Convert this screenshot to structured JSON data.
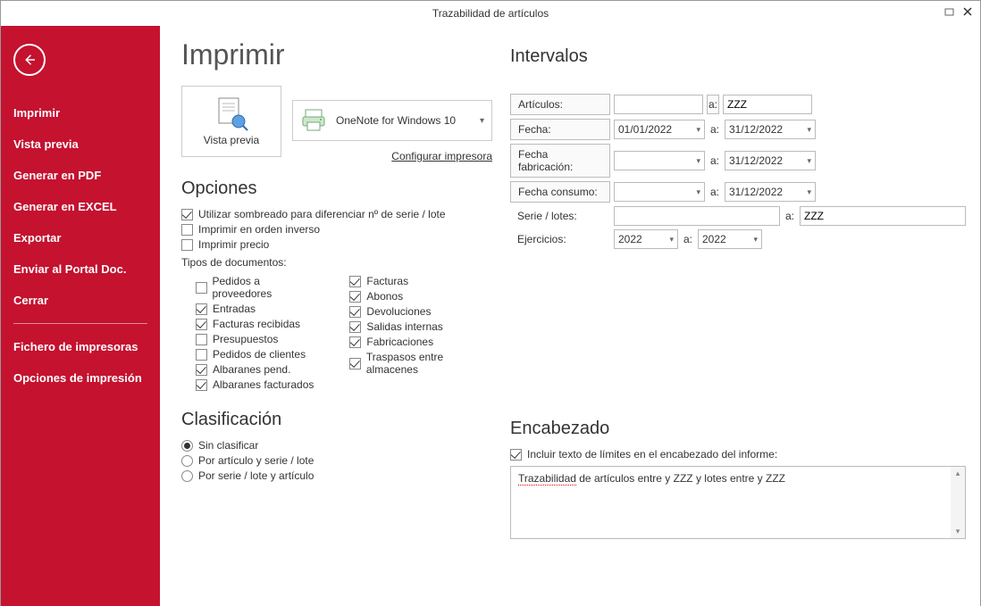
{
  "window": {
    "title": "Trazabilidad de artículos"
  },
  "sidebar": {
    "items": [
      "Imprimir",
      "Vista previa",
      "Generar en PDF",
      "Generar en EXCEL",
      "Exportar",
      "Enviar al Portal Doc.",
      "Cerrar"
    ],
    "items2": [
      "Fichero de impresoras",
      "Opciones de impresión"
    ]
  },
  "main": {
    "page_title": "Imprimir",
    "preview_label": "Vista previa",
    "printer_name": "OneNote for Windows 10",
    "config_link": "Configurar impresora",
    "opciones": {
      "title": "Opciones",
      "opt1": {
        "label": "Utilizar sombreado para diferenciar nº de serie / lote",
        "checked": true
      },
      "opt2": {
        "label": "Imprimir en orden inverso",
        "checked": false
      },
      "opt3": {
        "label": "Imprimir precio",
        "checked": false
      },
      "docs_label": "Tipos de documentos:",
      "docs_left": [
        {
          "label": "Pedidos a proveedores",
          "checked": false
        },
        {
          "label": "Entradas",
          "checked": true
        },
        {
          "label": "Facturas recibidas",
          "checked": true
        },
        {
          "label": "Presupuestos",
          "checked": false
        },
        {
          "label": "Pedidos de clientes",
          "checked": false
        },
        {
          "label": "Albaranes pend.",
          "checked": true
        },
        {
          "label": "Albaranes facturados",
          "checked": true
        }
      ],
      "docs_right": [
        {
          "label": "Facturas",
          "checked": true
        },
        {
          "label": "Abonos",
          "checked": true
        },
        {
          "label": "Devoluciones",
          "checked": true
        },
        {
          "label": "Salidas internas",
          "checked": true
        },
        {
          "label": "Fabricaciones",
          "checked": true
        },
        {
          "label": "Traspasos entre almacenes",
          "checked": true
        }
      ]
    },
    "clasificacion": {
      "title": "Clasificación",
      "opts": [
        {
          "label": "Sin clasificar",
          "on": true
        },
        {
          "label": "Por artículo y serie / lote",
          "on": false
        },
        {
          "label": "Por serie / lote y artículo",
          "on": false
        }
      ]
    },
    "intervalos": {
      "title": "Intervalos",
      "articulos_label": "Artículos:",
      "articulos_from": "",
      "articulos_to": "ZZZ",
      "fecha_label": "Fecha:",
      "fecha_from": "01/01/2022",
      "fecha_to": "31/12/2022",
      "fab_label": "Fecha fabricación:",
      "fab_from": "",
      "fab_to": "31/12/2022",
      "cons_label": "Fecha consumo:",
      "cons_from": "",
      "cons_to": "31/12/2022",
      "series_label": "Serie / lotes:",
      "series_from": "",
      "series_to": "ZZZ",
      "ejerc_label": "Ejercicios:",
      "ejerc_from": "2022",
      "ejerc_to": "2022",
      "a": "a:"
    },
    "encabezado": {
      "title": "Encabezado",
      "include_label": "Incluir texto de límites en el encabezado del informe:",
      "include_checked": true,
      "text_prefix": "Trazabilidad",
      "text_rest": " de artículos entre  y ZZZ y lotes entre  y ZZZ"
    }
  }
}
